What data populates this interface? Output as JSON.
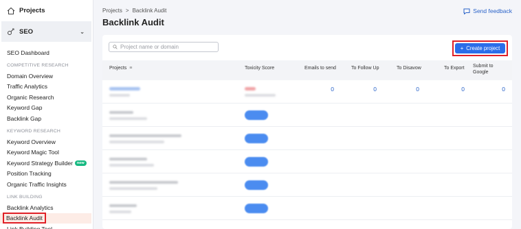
{
  "sidebar": {
    "projects_label": "Projects",
    "seo_label": "SEO",
    "items": [
      {
        "type": "item",
        "label": "SEO Dashboard"
      },
      {
        "type": "section",
        "label": "COMPETITIVE RESEARCH"
      },
      {
        "type": "item",
        "label": "Domain Overview"
      },
      {
        "type": "item",
        "label": "Traffic Analytics"
      },
      {
        "type": "item",
        "label": "Organic Research"
      },
      {
        "type": "item",
        "label": "Keyword Gap"
      },
      {
        "type": "item",
        "label": "Backlink Gap"
      },
      {
        "type": "section",
        "label": "KEYWORD RESEARCH"
      },
      {
        "type": "item",
        "label": "Keyword Overview"
      },
      {
        "type": "item",
        "label": "Keyword Magic Tool"
      },
      {
        "type": "item",
        "label": "Keyword Strategy Builder",
        "badge": "new"
      },
      {
        "type": "item",
        "label": "Position Tracking"
      },
      {
        "type": "item",
        "label": "Organic Traffic Insights"
      },
      {
        "type": "section",
        "label": "LINK BUILDING"
      },
      {
        "type": "item",
        "label": "Backlink Analytics"
      },
      {
        "type": "item",
        "label": "Backlink Audit",
        "active": true
      },
      {
        "type": "item",
        "label": "Link Building Tool"
      }
    ]
  },
  "breadcrumb": {
    "root": "Projects",
    "separator": ">",
    "current": "Backlink Audit"
  },
  "feedback_label": "Send feedback",
  "page_title": "Backlink Audit",
  "search": {
    "placeholder": "Project name or domain"
  },
  "create_button": {
    "label": "Create project",
    "icon": "+"
  },
  "table": {
    "columns": {
      "projects": "Projects",
      "toxicity": "Toxicity Score",
      "emails": "Emails to send",
      "follow_up": "To Follow Up",
      "disavow": "To Disavow",
      "export": "To Export",
      "submit_line1": "Submit to",
      "submit_line2": "Google"
    },
    "first_row": {
      "emails": "0",
      "follow_up": "0",
      "disavow": "0",
      "export": "0",
      "submit": "0"
    }
  },
  "colors": {
    "accent": "#2b6de9",
    "highlight": "#e01f26",
    "link": "#2a63c9"
  }
}
